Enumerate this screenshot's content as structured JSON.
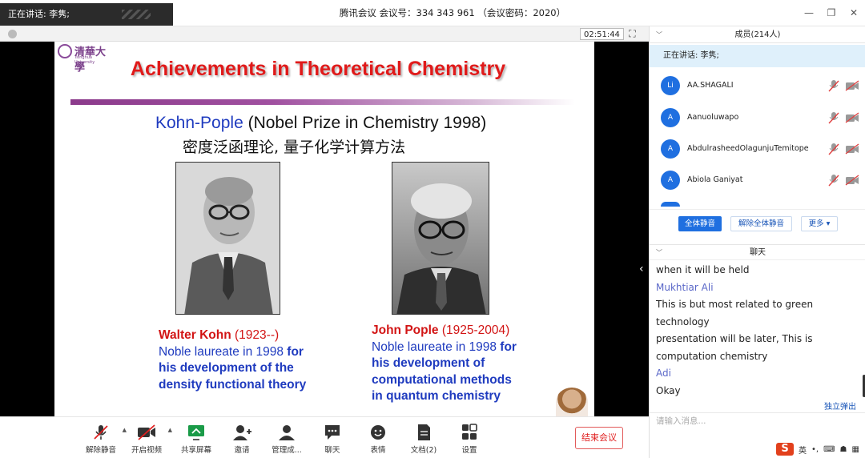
{
  "window": {
    "speaker_toast": "正在讲话: 李隽;",
    "title": "腾讯会议 会议号：334 343 961 （会议密码：2020）",
    "controls": [
      "—",
      "❐",
      "✕"
    ]
  },
  "stage": {
    "timer": "02:51:44"
  },
  "slide": {
    "logo_text": "清華大學",
    "logo_sub": "Tsinghua University",
    "title": "Achievements in Theoretical Chemistry",
    "subtitle_blue": "Kohn-Pople",
    "subtitle_rest": " (Nobel Prize in Chemistry 1998)",
    "subtitle_cn": "密度泛函理论, 量子化学计算方法",
    "kohn": {
      "name": "Walter Kohn",
      "years": " (1923--)",
      "line1_normal": "Noble laureate in 1998 ",
      "line1_bold": "for",
      "line2": "his development of the",
      "line3": "density functional theory"
    },
    "pople": {
      "name": "John Pople",
      "years": " (1925-2004)",
      "line1_normal": "Noble laureate in 1998 ",
      "line1_bold": "for",
      "line2": "his development of",
      "line3": "computational methods",
      "line4": "in quantum chemistry"
    }
  },
  "toolbar": {
    "unmute": "解除静音",
    "video": "开启视频",
    "share": "共享屏幕",
    "invite": "邀请",
    "manage": "管理成...",
    "chat": "聊天",
    "emoji": "表情",
    "docs": "文档(2)",
    "settings": "设置",
    "end": "结束会议"
  },
  "members": {
    "header": "成员(214人)",
    "now_speaking": "正在讲话: 李隽;",
    "list": [
      {
        "initial": "Li",
        "name": "AA.SHAGALI"
      },
      {
        "initial": "A",
        "name": "Aanuoluwapo"
      },
      {
        "initial": "A",
        "name": "AbdulrasheedOlagunjuTemitope"
      },
      {
        "initial": "A",
        "name": "Abiola Ganiyat"
      }
    ],
    "mute_all": "全体静音",
    "unmute_all": "解除全体静音",
    "more": "更多 ▾"
  },
  "chat": {
    "header": "聊天",
    "line1": "when it will be held",
    "sender1": "Mukhtiar Ali",
    "msg1a": "This is but most related to green technology",
    "msg1b": "presentation will be later, This is",
    "msg1c": "computation chemistry",
    "sender2": "Adi",
    "msg2": "Okay",
    "popout": "独立弹出",
    "placeholder": "请输入消息...",
    "ime_lang": "英"
  },
  "colors": {
    "accent": "#1f6fe0",
    "slide_title": "#e01a1a",
    "slide_blue": "#1f3bbf",
    "end_red": "#e02020"
  }
}
